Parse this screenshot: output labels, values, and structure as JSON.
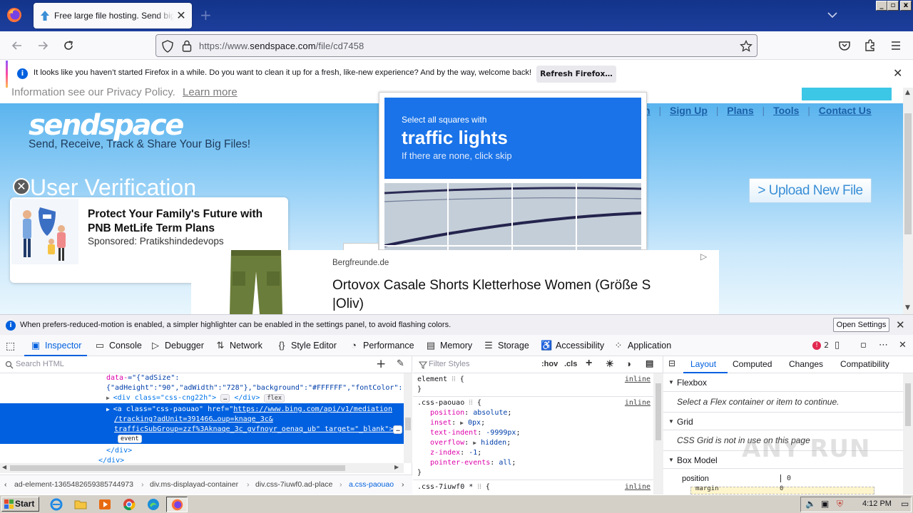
{
  "browser": {
    "tab_title": "Free large file hosting. Send big files",
    "new_tab": "+",
    "url_prefix": "https://www.",
    "url_domain": "sendspace.com",
    "url_path": "/file/cd7458",
    "window_buttons": [
      "_",
      "▫",
      "x"
    ]
  },
  "notification": {
    "message": "It looks like you haven’t started Firefox in a while. Do you want to clean it up for a fresh, like-new experience? And by the way, welcome back!",
    "button": "Refresh Firefox…"
  },
  "page": {
    "privacy_text": "Information see our Privacy Policy.",
    "learn_more": "Learn more",
    "logo": "sendspace",
    "tagline": "Send, Receive, Track & Share Your Big Files!",
    "nav_links": [
      "n",
      "Sign Up",
      "Plans",
      "Tools",
      "Contact Us"
    ],
    "verification_title": "User Verification",
    "upload_button": "> Upload New File",
    "ad_card": {
      "headline": "Protect Your Family's Future with PNB MetLife Term Plans",
      "sponsor": "Sponsored: Pratikshindedevops"
    },
    "captcha": {
      "line1": "Select all squares with",
      "line2": "traffic lights",
      "line3": "If there are none, click skip"
    },
    "product_ad": {
      "brand": "Bergfreunde.de",
      "title": "Ortovox Casale Shorts Kletterhose Women (Größe S |Oliv)"
    }
  },
  "devtools": {
    "warning": "When prefers-reduced-motion is enabled, a simpler highlighter can be enabled in the settings panel, to avoid flashing colors.",
    "open_settings": "Open Settings",
    "tabs": [
      "Inspector",
      "Console",
      "Debugger",
      "Network",
      "Style Editor",
      "Performance",
      "Memory",
      "Storage",
      "Accessibility",
      "Application"
    ],
    "error_count": "2",
    "search_placeholder": "Search HTML",
    "markup": {
      "l1_attr": "data-",
      "l1_rest": "=\"{\"adSize\":",
      "l2": "{\"adHeight\":\"90\",\"adWidth\":\"728\"},\"background\":\"#FFFFFF\",\"fontColor\":",
      "l3_tag": "<div class=\"css-cng22h\">",
      "l3_dots": "…",
      "l3_close": "</div>",
      "l3_badge": "flex",
      "sel1_open": "<a class=\"css-paouao\" href=\"",
      "sel1_url": "https://www.bing.com/api/v1/mediation",
      "sel2": "/tracking?adUnit=391466…oup=knaqe_3c&",
      "sel3": "trafficSubGroup=zzf%3Aknaqe_3c_gvfnoyr_oenaq_ub\" target=\"_blank\">",
      "sel_dots": "…",
      "sel_badge": "event",
      "l_close_div": "</div>",
      "l_close_div2": "</div>"
    },
    "breadcrumbs": [
      "ad-element-1365482659385744973",
      "div.ms-displayad-container",
      "div.css-7iuwf0.ad-place",
      "a.css-paouao"
    ],
    "rules": {
      "filter_placeholder": "Filter Styles",
      "hov": ":hov",
      "cls": ".cls",
      "element_selector": "element",
      "inline": "inline",
      "selector1": ".css-paouao",
      "props": [
        {
          "name": "position",
          "value": "absolute"
        },
        {
          "name": "inset",
          "value": "0px"
        },
        {
          "name": "text-indent",
          "value": "-9999px"
        },
        {
          "name": "overflow",
          "value": "hidden"
        },
        {
          "name": "z-index",
          "value": "-1"
        },
        {
          "name": "pointer-events",
          "value": "all"
        }
      ],
      "selector2": ".css-7iuwf0 *"
    },
    "layout": {
      "tabs": [
        "Layout",
        "Computed",
        "Changes",
        "Compatibility"
      ],
      "flexbox": "Flexbox",
      "flexbox_note": "Select a Flex container or item to continue.",
      "grid": "Grid",
      "grid_note": "CSS Grid is not in use on this page",
      "box_model": "Box Model",
      "position_label": "position",
      "position_value": "0",
      "margin_label": "margin",
      "margin_value": "0"
    },
    "watermark": "ANY RUN"
  },
  "taskbar": {
    "start": "Start",
    "time": "4:12 PM"
  },
  "colors": {
    "accent": "#0060df",
    "titlebar": "#1d3f9c",
    "captcha_header": "#1a73e8"
  }
}
